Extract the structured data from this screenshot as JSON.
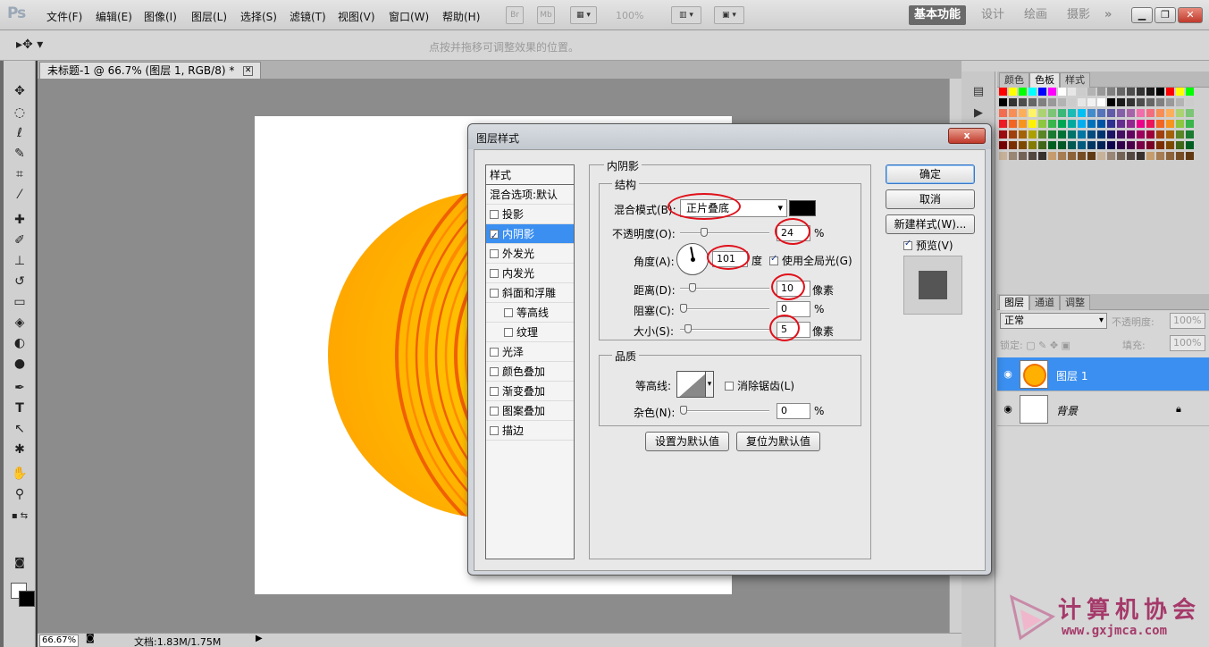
{
  "app": {
    "logo": "Ps"
  },
  "menu": [
    "文件(F)",
    "编辑(E)",
    "图像(I)",
    "图层(L)",
    "选择(S)",
    "滤镜(T)",
    "视图(V)",
    "窗口(W)",
    "帮助(H)"
  ],
  "toolbar": {
    "bridge": "Br",
    "minibridge": "Mb",
    "zoom": "100%"
  },
  "workspaces": {
    "essentials": "基本功能",
    "design": "设计",
    "painting": "绘画",
    "photography": "摄影",
    "more": "»"
  },
  "options": {
    "tool_icon": "move-tool-icon",
    "hint": "点按并拖移可调整效果的位置。"
  },
  "document": {
    "tab_title": "未标题-1 @ 66.7% (图层 1, RGB/8) *",
    "zoom": "66.67%",
    "info": "文档:1.83M/1.75M"
  },
  "swatches_panel": {
    "tabs": [
      "颜色",
      "色板",
      "样式"
    ],
    "active_tab": "色板"
  },
  "layers_panel": {
    "tabs": [
      "图层",
      "通道",
      "调整"
    ],
    "blend_mode": "正常",
    "opacity_label": "不透明度:",
    "opacity": "100%",
    "lock_label": "锁定:",
    "fill_label": "填充:",
    "fill": "100%",
    "layers": [
      {
        "name": "图层 1",
        "selected": true
      },
      {
        "name": "背景",
        "selected": false,
        "locked": true
      }
    ]
  },
  "dialog": {
    "title": "图层样式",
    "close": "x",
    "styles_header": "样式",
    "styles": [
      {
        "label": "混合选项:默认",
        "checkbox": false,
        "indent": false,
        "checked": false
      },
      {
        "label": "投影",
        "checkbox": true,
        "indent": false,
        "checked": false
      },
      {
        "label": "内阴影",
        "checkbox": true,
        "indent": false,
        "checked": true,
        "selected": true
      },
      {
        "label": "外发光",
        "checkbox": true,
        "indent": false,
        "checked": false
      },
      {
        "label": "内发光",
        "checkbox": true,
        "indent": false,
        "checked": false
      },
      {
        "label": "斜面和浮雕",
        "checkbox": true,
        "indent": false,
        "checked": false
      },
      {
        "label": "等高线",
        "checkbox": true,
        "indent": true,
        "checked": false
      },
      {
        "label": "纹理",
        "checkbox": true,
        "indent": true,
        "checked": false
      },
      {
        "label": "光泽",
        "checkbox": true,
        "indent": false,
        "checked": false
      },
      {
        "label": "颜色叠加",
        "checkbox": true,
        "indent": false,
        "checked": false
      },
      {
        "label": "渐变叠加",
        "checkbox": true,
        "indent": false,
        "checked": false
      },
      {
        "label": "图案叠加",
        "checkbox": true,
        "indent": false,
        "checked": false
      },
      {
        "label": "描边",
        "checkbox": true,
        "indent": false,
        "checked": false
      }
    ],
    "inner_shadow": {
      "group_title": "内阴影",
      "structure_title": "结构",
      "blend_label": "混合模式(B):",
      "blend_value": "正片叠底",
      "color": "#000000",
      "opacity_label": "不透明度(O):",
      "opacity": "24",
      "opacity_unit": "%",
      "angle_label": "角度(A):",
      "angle": "101",
      "angle_unit": "度",
      "global_light_label": "使用全局光(G)",
      "distance_label": "距离(D):",
      "distance": "10",
      "distance_unit": "像素",
      "choke_label": "阻塞(C):",
      "choke": "0",
      "choke_unit": "%",
      "size_label": "大小(S):",
      "size": "5",
      "size_unit": "像素",
      "quality_title": "品质",
      "contour_label": "等高线:",
      "antialias_label": "消除锯齿(L)",
      "noise_label": "杂色(N):",
      "noise": "0",
      "noise_unit": "%",
      "make_default": "设置为默认值",
      "reset_default": "复位为默认值"
    },
    "buttons": {
      "ok": "确定",
      "cancel": "取消",
      "new_style": "新建样式(W)...",
      "preview": "预览(V)"
    }
  },
  "watermark": {
    "text": "计算机协会",
    "url": "www.gxjmca.com"
  }
}
